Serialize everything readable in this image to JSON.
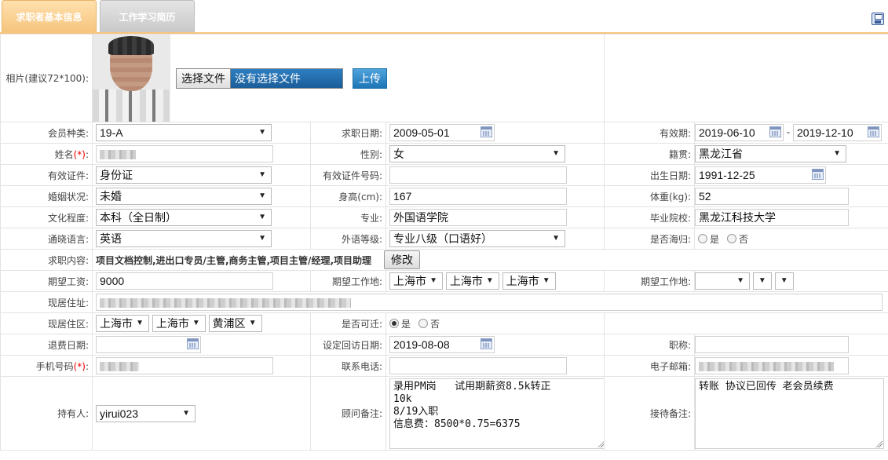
{
  "tabs": [
    {
      "label": "求职者基本信息",
      "active": true
    },
    {
      "label": "工作学习简历",
      "active": false
    }
  ],
  "photo": {
    "label": "相片(建议72*100):",
    "file_button": "选择文件",
    "file_name": "没有选择文件",
    "upload_button": "上传"
  },
  "fields": {
    "member_type": {
      "label": "会员种类:",
      "value": "19-A"
    },
    "apply_date": {
      "label": "求职日期:",
      "value": "2009-05-01"
    },
    "valid_period": {
      "label": "有效期:",
      "start": "2019-06-10",
      "sep": "-",
      "end": "2019-12-10"
    },
    "name": {
      "label": "姓名",
      "req": "(*)",
      "colon": ":"
    },
    "gender": {
      "label": "性别:",
      "value": "女"
    },
    "native_place": {
      "label": "籍贯:",
      "value": "黑龙江省"
    },
    "id_type": {
      "label": "有效证件:",
      "value": "身份证"
    },
    "id_number": {
      "label": "有效证件号码:",
      "value": ""
    },
    "birth_date": {
      "label": "出生日期:",
      "value": "1991-12-25"
    },
    "marital": {
      "label": "婚姻状况:",
      "value": "未婚"
    },
    "height": {
      "label": "身高(cm):",
      "value": "167"
    },
    "weight": {
      "label": "体重(kg):",
      "value": "52"
    },
    "education": {
      "label": "文化程度:",
      "value": "本科（全日制）"
    },
    "major": {
      "label": "专业:",
      "value": "外国语学院"
    },
    "school": {
      "label": "毕业院校:",
      "value": "黑龙江科技大学"
    },
    "language": {
      "label": "通晓语言:",
      "value": "英语"
    },
    "lang_level": {
      "label": "外语等级:",
      "value": "专业八级（口语好）"
    },
    "returnee": {
      "label": "是否海归:",
      "yes": "是",
      "no": "否"
    },
    "job_content": {
      "label": "求职内容:",
      "value": "项目文档控制,进出口专员/主管,商务主管,项目主管/经理,项目助理",
      "button": "修改"
    },
    "expected_salary": {
      "label": "期望工资:",
      "value": "9000"
    },
    "expected_loc1": {
      "label": "期望工作地:",
      "v1": "上海市",
      "v2": "上海市",
      "v3": "上海市"
    },
    "expected_loc2": {
      "label": "期望工作地:"
    },
    "address": {
      "label": "现居住址:"
    },
    "district": {
      "label": "现居住区:",
      "v1": "上海市",
      "v2": "上海市",
      "v3": "黄浦区"
    },
    "relocate": {
      "label": "是否可迁:",
      "yes": "是",
      "no": "否"
    },
    "refund_date": {
      "label": "退费日期:",
      "value": ""
    },
    "callback_date": {
      "label": "设定回访日期:",
      "value": "2019-08-08"
    },
    "title": {
      "label": "职称:",
      "value": ""
    },
    "mobile": {
      "label": "手机号码",
      "req": "(*)",
      "colon": ":"
    },
    "phone": {
      "label": "联系电话:",
      "value": ""
    },
    "email": {
      "label": "电子邮箱:"
    },
    "holder": {
      "label": "持有人:",
      "value": "yirui023"
    },
    "advisor_note": {
      "label": "顾问备注:",
      "value": "录用PM岗   试用期薪资8.5k转正\n10k\n8/19入职\n信息费：8500*0.75=6375"
    },
    "reception_note": {
      "label": "接待备注:",
      "value": "转账 协议已回传 老会员续费"
    }
  },
  "icons": {
    "save": "save-icon",
    "calendar": "calendar-icon",
    "dropdown": "chevron-down-icon"
  },
  "colors": {
    "tab_active": "#f6c57e",
    "tab_inactive": "#c9c9c9",
    "upload_button": "#1e75b5",
    "required": "#e00000"
  }
}
